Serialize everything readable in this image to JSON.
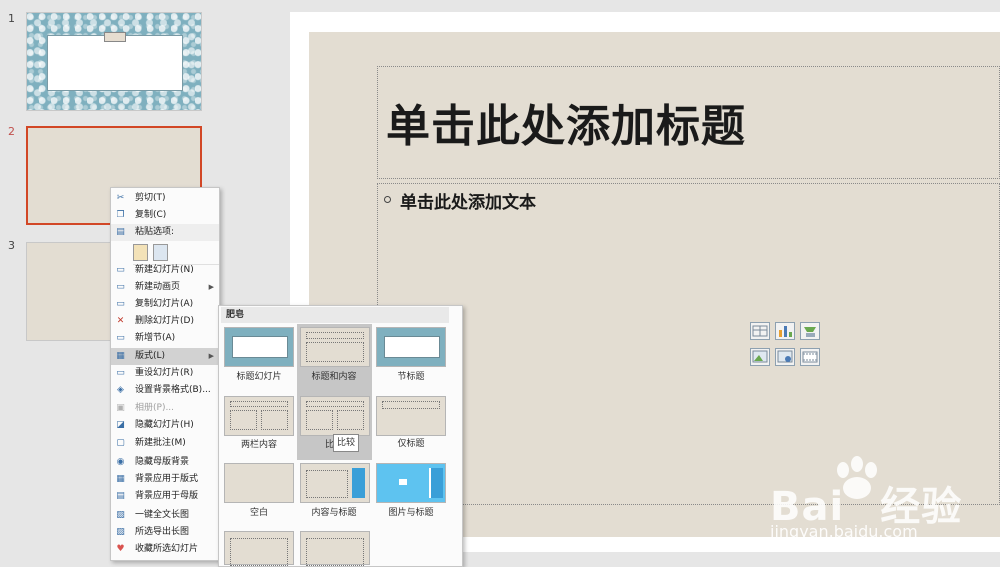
{
  "slides": [
    {
      "number": "1"
    },
    {
      "number": "2"
    },
    {
      "number": "3"
    }
  ],
  "main_slide": {
    "title_placeholder": "单击此处添加标题",
    "body_placeholder": "单击此处添加文本"
  },
  "context_menu": {
    "items": [
      {
        "label": "剪切(T)",
        "icon": "scissors-icon"
      },
      {
        "label": "复制(C)",
        "icon": "copy-icon"
      },
      {
        "label": "粘贴选项:",
        "icon": "paste-icon"
      },
      {
        "label": "新建幻灯片(N)",
        "icon": "new-slide-icon"
      },
      {
        "label": "新建动画页",
        "icon": "animation-page-icon"
      },
      {
        "label": "复制幻灯片(A)",
        "icon": "duplicate-slide-icon"
      },
      {
        "label": "删除幻灯片(D)",
        "icon": "delete-slide-icon"
      },
      {
        "label": "新增节(A)",
        "icon": "section-icon"
      },
      {
        "label": "版式(L)",
        "icon": "layout-icon"
      },
      {
        "label": "重设幻灯片(R)",
        "icon": "reset-icon"
      },
      {
        "label": "设置背景格式(B)...",
        "icon": "background-icon"
      },
      {
        "label": "相册(P)...",
        "icon": "album-icon"
      },
      {
        "label": "隐藏幻灯片(H)",
        "icon": "hide-slide-icon"
      },
      {
        "label": "新建批注(M)",
        "icon": "comment-icon"
      },
      {
        "label": "隐藏母版背景",
        "icon": "eye-icon"
      },
      {
        "label": "背景应用于版式",
        "icon": "apply-layout-icon"
      },
      {
        "label": "背景应用于母版",
        "icon": "apply-master-icon"
      },
      {
        "label": "一键全文长图",
        "icon": "long-image-icon"
      },
      {
        "label": "所选导出长图",
        "icon": "export-image-icon"
      },
      {
        "label": "收藏所选幻灯片",
        "icon": "favorite-icon"
      }
    ]
  },
  "layout_menu": {
    "header": "肥皂",
    "layouts": [
      {
        "label": "标题幻灯片"
      },
      {
        "label": "标题和内容"
      },
      {
        "label": "节标题"
      },
      {
        "label": "两栏内容"
      },
      {
        "label": "比较"
      },
      {
        "label": "仅标题"
      },
      {
        "label": "空白"
      },
      {
        "label": "内容与标题"
      },
      {
        "label": "图片与标题"
      }
    ],
    "tooltip": "比较"
  },
  "watermark": {
    "brand": "Bai",
    "brand2": "经验",
    "url": "jingyan.baidu.com"
  },
  "colors": {
    "accent": "#d24726",
    "slide_bg": "#e3ddd2",
    "pattern": "#7fb0bf",
    "highlight": "#d2d2d2"
  }
}
